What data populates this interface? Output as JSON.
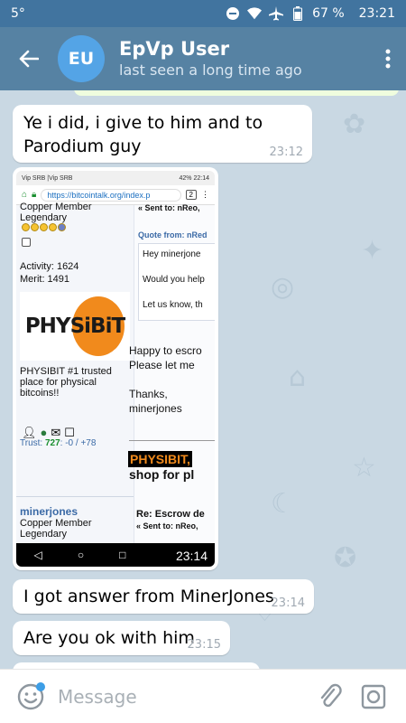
{
  "status_bar": {
    "left": "5°",
    "battery": "67 %",
    "time": "23:21"
  },
  "header": {
    "avatar_initials": "EU",
    "title": "EpVp User",
    "subtitle": "last seen a long time ago"
  },
  "messages": [
    {
      "text": "Ye i did, i give to him and to Parodium guy",
      "time": "23:12"
    },
    {
      "type": "photo",
      "time": "23:14"
    },
    {
      "text": "I got answer from MinerJones",
      "time": "23:14"
    },
    {
      "text": "Are you ok with him",
      "time": "23:15"
    }
  ],
  "screenshot": {
    "status_left": "Vip SRB |Vip SRB",
    "status_right": "42% 22:14",
    "url": "https://bitcointalk.org/index.p",
    "tab_count": "2",
    "rank": "Copper Member",
    "rank2": "Legendary",
    "activity": "Activity: 1624",
    "merit": "Merit: 1491",
    "logo": "PHYSiBiT",
    "desc": "PHYSIBIT #1 trusted place for physical bitcoins!!",
    "trust_label": "Trust:",
    "trust_value": "727",
    "trust_rest": ": -0 / +78",
    "user2": "minerjones",
    "user2_rank": "Copper Member",
    "user2_rank2": "Legendary",
    "sent_to": "« Sent to: nReo,",
    "quote_from": "Quote from: nRed",
    "q1": "Hey minerjone",
    "q2": "Would you help",
    "q3": "Let us know, th",
    "reply1": "Happy to escro",
    "reply2": "Please let me",
    "thanks": "Thanks,",
    "sign": "minerjones",
    "badge": "PHYSIBIT,",
    "shop": "shop for pl",
    "re_title": "Re: Escrow de",
    "sent_to2": "« Sent to: nReo,",
    "nav_time": "23:14"
  },
  "input": {
    "placeholder": "Message"
  }
}
